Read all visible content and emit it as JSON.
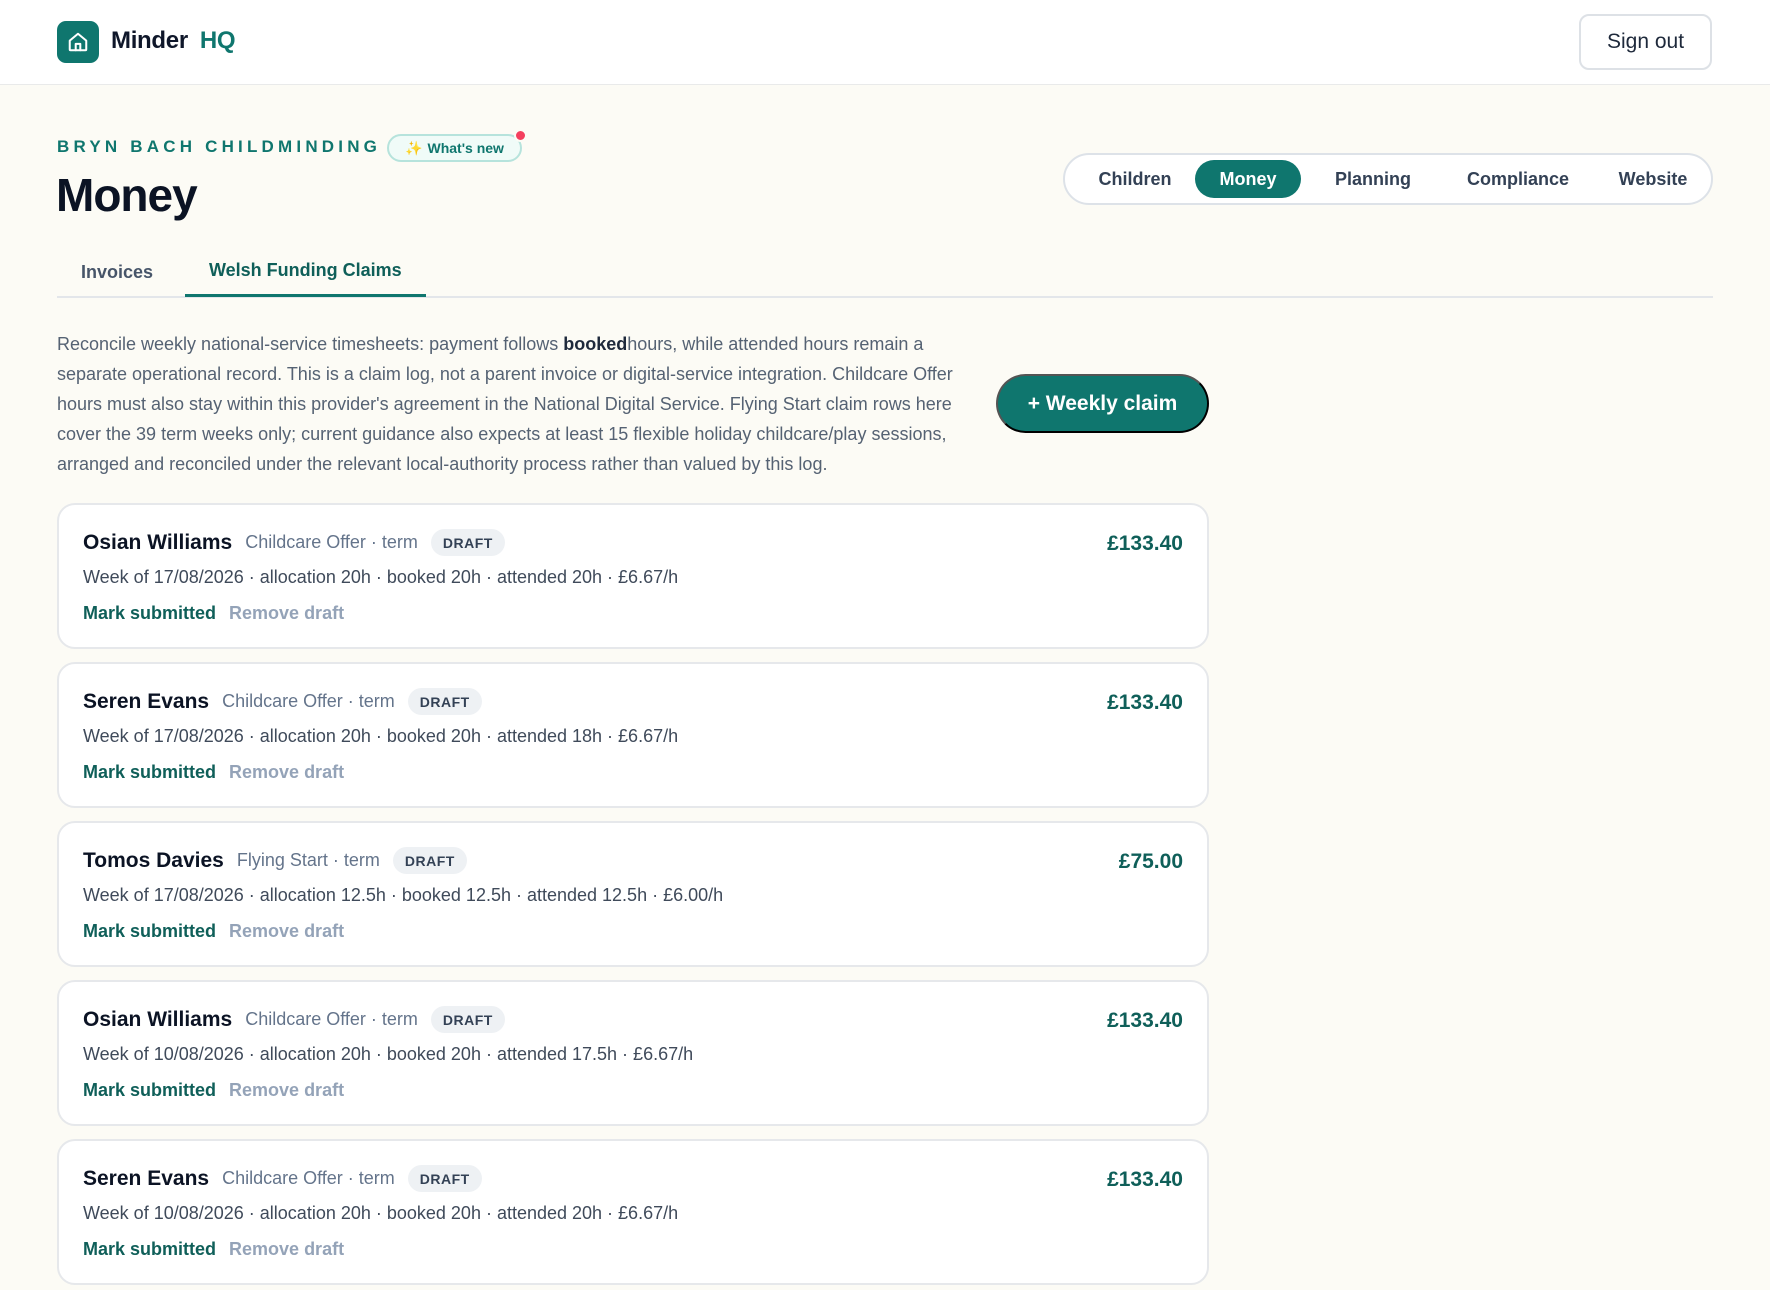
{
  "app": {
    "brand_primary": "Minder",
    "brand_secondary": "HQ",
    "logo_icon": "home-icon",
    "sign_out_label": "Sign out"
  },
  "header": {
    "org_name": "BRYN BACH CHILDMINDING",
    "whats_new_label": "What's new",
    "whats_new_icon": "sparkles-icon",
    "page_title": "Money"
  },
  "main_nav": {
    "items": [
      "Children",
      "Money",
      "Planning",
      "Compliance",
      "Website"
    ],
    "active": "Money"
  },
  "tabs": {
    "items": [
      "Invoices",
      "Welsh Funding Claims"
    ],
    "active": "Welsh Funding Claims"
  },
  "intro": {
    "before_bold": "Reconcile weekly national-service timesheets: payment follows ",
    "bold": "booked",
    "after_bold": "hours, while attended hours remain a separate operational record. This is a claim log, not a parent invoice or digital-service integration. Childcare Offer hours must also stay within this provider's agreement in the National Digital Service. Flying Start claim rows here cover the 39 term weeks only; current guidance also expects at least 15 flexible holiday childcare/play sessions, arranged and reconciled under the relevant local-authority process rather than valued by this log."
  },
  "weekly_claim_label": "+ Weekly claim",
  "claims": [
    {
      "name": "Osian Williams",
      "type": "Childcare Offer · term",
      "status": "DRAFT",
      "amount": "£133.40",
      "detail": "Week of 17/08/2026 · allocation 20h · booked 20h · attended 20h · £6.67/h",
      "mark_label": "Mark submitted",
      "remove_label": "Remove draft"
    },
    {
      "name": "Seren Evans",
      "type": "Childcare Offer · term",
      "status": "DRAFT",
      "amount": "£133.40",
      "detail": "Week of 17/08/2026 · allocation 20h · booked 20h · attended 18h · £6.67/h",
      "mark_label": "Mark submitted",
      "remove_label": "Remove draft"
    },
    {
      "name": "Tomos Davies",
      "type": "Flying Start · term",
      "status": "DRAFT",
      "amount": "£75.00",
      "detail": "Week of 17/08/2026 · allocation 12.5h · booked 12.5h · attended 12.5h · £6.00/h",
      "mark_label": "Mark submitted",
      "remove_label": "Remove draft"
    },
    {
      "name": "Osian Williams",
      "type": "Childcare Offer · term",
      "status": "DRAFT",
      "amount": "£133.40",
      "detail": "Week of 10/08/2026 · allocation 20h · booked 20h · attended 17.5h · £6.67/h",
      "mark_label": "Mark submitted",
      "remove_label": "Remove draft"
    },
    {
      "name": "Seren Evans",
      "type": "Childcare Offer · term",
      "status": "DRAFT",
      "amount": "£133.40",
      "detail": "Week of 10/08/2026 · allocation 20h · booked 20h · attended 20h · £6.67/h",
      "mark_label": "Mark submitted",
      "remove_label": "Remove draft"
    }
  ],
  "colors": {
    "accent": "#0f766e",
    "background": "#fcfbf5",
    "notification": "#f43f5e"
  }
}
